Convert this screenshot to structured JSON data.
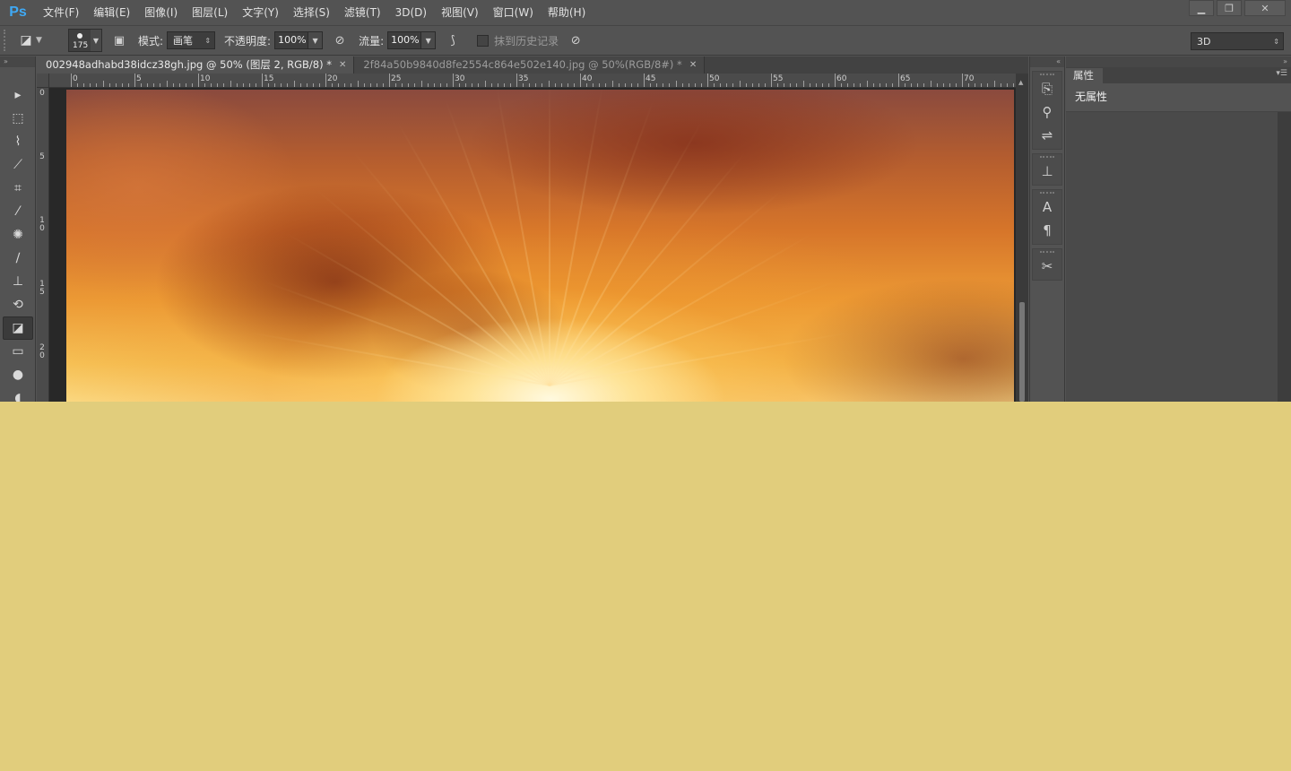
{
  "app": {
    "logo": "Ps"
  },
  "menu": [
    "文件(F)",
    "编辑(E)",
    "图像(I)",
    "图层(L)",
    "文字(Y)",
    "选择(S)",
    "滤镜(T)",
    "3D(D)",
    "视图(V)",
    "窗口(W)",
    "帮助(H)"
  ],
  "window_controls": {
    "minimize": "▁",
    "restore": "❐",
    "close": "✕"
  },
  "options": {
    "brush_size": "175",
    "mode_label": "模式:",
    "mode_value": "画笔",
    "opacity_label": "不透明度:",
    "opacity_value": "100%",
    "flow_label": "流量:",
    "flow_value": "100%",
    "erase_history_label": "抹到历史记录",
    "workspace": "3D"
  },
  "tabs": [
    {
      "title": "002948adhabd38idcz38gh.jpg @ 50% (图层 2, RGB/8) *",
      "active": true
    },
    {
      "title": "2f84a50b9840d8fe2554c864e502e140.jpg @ 50%(RGB/8#) *",
      "active": false
    }
  ],
  "ruler": {
    "horizontal": [
      "0",
      "5",
      "10",
      "15",
      "20",
      "25",
      "30",
      "35",
      "40",
      "45",
      "50",
      "55",
      "60",
      "65",
      "70"
    ],
    "vertical": [
      "0",
      "5",
      "1 0",
      "1 5",
      "2 0"
    ]
  },
  "tools": [
    {
      "name": "move-tool",
      "glyph": "▸"
    },
    {
      "name": "marquee-tool",
      "glyph": "⬚"
    },
    {
      "name": "lasso-tool",
      "glyph": "⌇"
    },
    {
      "name": "quick-select-tool",
      "glyph": "⟋"
    },
    {
      "name": "crop-tool",
      "glyph": "⌗"
    },
    {
      "name": "eyedropper-tool",
      "glyph": "⁄"
    },
    {
      "name": "healing-tool",
      "glyph": "✺"
    },
    {
      "name": "brush-tool",
      "glyph": "∕"
    },
    {
      "name": "stamp-tool",
      "glyph": "⊥"
    },
    {
      "name": "history-brush-tool",
      "glyph": "⟲"
    },
    {
      "name": "eraser-tool",
      "glyph": "◪"
    },
    {
      "name": "gradient-tool",
      "glyph": "▭"
    },
    {
      "name": "blur-tool",
      "glyph": "●"
    },
    {
      "name": "dodge-tool",
      "glyph": "◖"
    }
  ],
  "dock_icons": [
    [
      "history-icon",
      "actions-icon",
      "adjustments-icon"
    ],
    [
      "brush-panel-icon"
    ],
    [
      "character-icon",
      "paragraph-icon"
    ],
    [
      "tool-presets-icon"
    ]
  ],
  "dock_glyphs": {
    "history-icon": "⎘",
    "actions-icon": "⚲",
    "adjustments-icon": "⇌",
    "brush-panel-icon": "⊥",
    "character-icon": "A",
    "paragraph-icon": "¶",
    "tool-presets-icon": "✂"
  },
  "properties": {
    "tab_label": "属性",
    "content": "无属性"
  },
  "colors": {
    "ui_bg": "#535353",
    "accent_logo": "#3fa9f5",
    "overlay_bg": "#e1cd7c"
  }
}
